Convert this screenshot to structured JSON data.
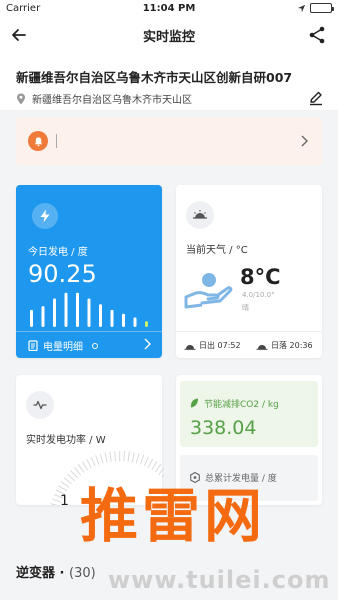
{
  "status_bar": {
    "carrier": "Carrier",
    "time": "11:04 PM"
  },
  "nav": {
    "title": "实时监控",
    "back_icon": "arrow-left-icon",
    "share_icon": "share-icon"
  },
  "station": {
    "name": "新疆维吾尔自治区乌鲁木齐市天山区创新自研007",
    "address": "新疆维吾尔自治区乌鲁木齐市天山区"
  },
  "alert": {
    "icon": "bell-icon",
    "color": "#f07a3a"
  },
  "generation": {
    "label": "今日发电 / 度",
    "value": "90.25",
    "detail_label": "电量明细",
    "bar_levels": [
      0.45,
      0.55,
      0.75,
      0.9,
      0.9,
      0.75,
      0.6,
      0.45,
      0.35,
      0.25,
      0.15
    ],
    "bar_count_highlight": 1,
    "accent": "#1e97ee"
  },
  "weather": {
    "label": "当前天气 / °C",
    "temperature": "8°C",
    "range": "4.0/10.0°",
    "condition": "晴",
    "sunrise": "日出 07:52",
    "sunset": "日落 20:36"
  },
  "power": {
    "label": "实时发电功率 / W",
    "value_partial": "1"
  },
  "co2": {
    "label": "节能减排CO2 / kg",
    "value": "338.04",
    "total_label": "总累计发电量 / 度",
    "color": "#55a148"
  },
  "section": {
    "title": "逆变器 ·",
    "count": "(30)"
  },
  "watermark": {
    "text": "推雷网",
    "url": "www.tuilei.com",
    "color": "#f46a10"
  }
}
